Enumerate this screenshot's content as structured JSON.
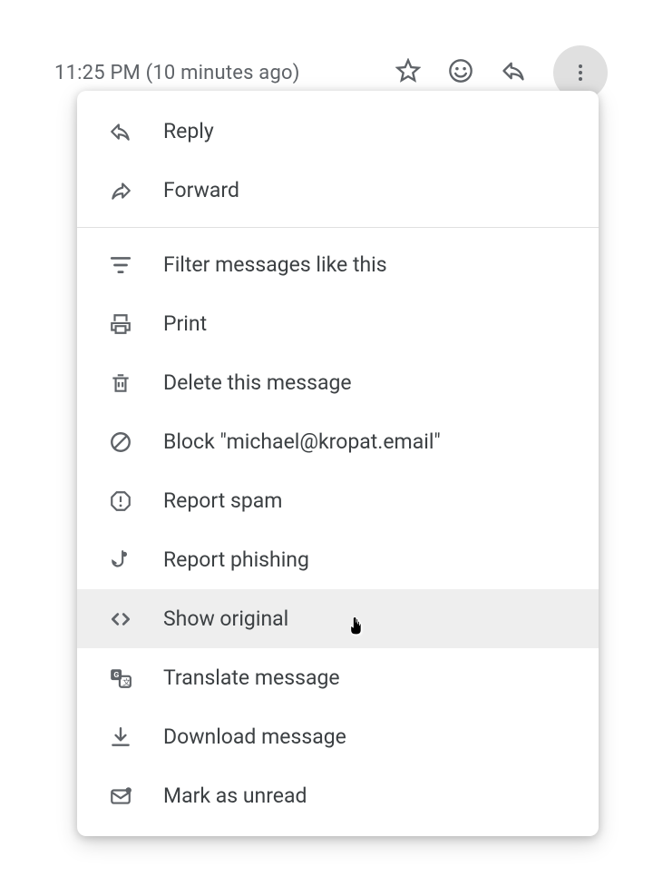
{
  "timestamp": "11:25 PM (10 minutes ago)",
  "menu": {
    "reply": "Reply",
    "forward": "Forward",
    "filter": "Filter messages like this",
    "print": "Print",
    "delete": "Delete this message",
    "block": "Block \"michael@kropat.email\"",
    "spam": "Report spam",
    "phishing": "Report phishing",
    "show_original": "Show original",
    "translate": "Translate message",
    "download": "Download message",
    "mark_unread": "Mark as unread"
  }
}
